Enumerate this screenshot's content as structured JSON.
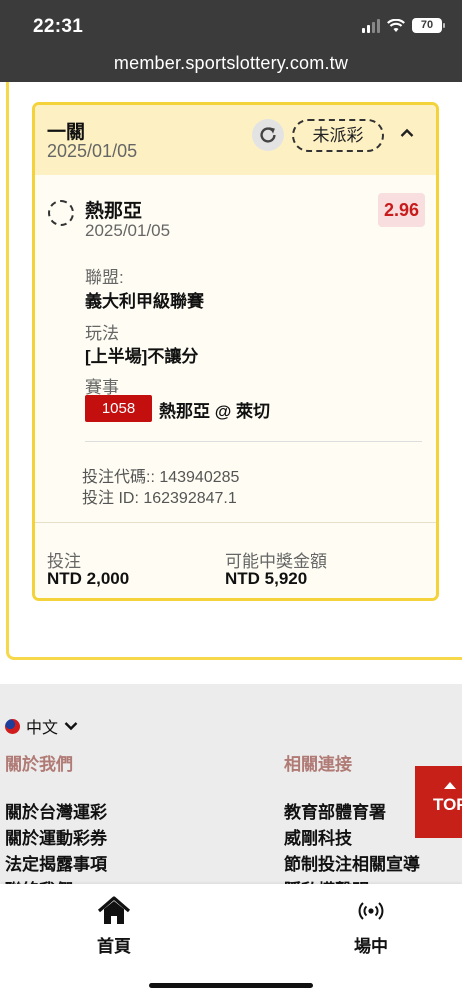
{
  "status_bar": {
    "time": "22:31",
    "battery": "70",
    "icons": [
      "cellular-signal-icon",
      "wifi-icon",
      "battery-icon"
    ]
  },
  "browser": {
    "url": "member.sportslottery.com.tw"
  },
  "ticket": {
    "type": "一關",
    "date": "2025/01/05",
    "status": "未派彩",
    "refresh_icon": "refresh-icon",
    "collapse_icon": "chevron-up-icon",
    "leg": {
      "team": "熱那亞",
      "date": "2025/01/05",
      "odds": "2.96",
      "league_label": "聯盟:",
      "league": "義大利甲級聯賽",
      "play_label": "玩法",
      "play": "[上半場]不讓分",
      "event_label": "賽事",
      "match_no": "1058",
      "match": "熱那亞 @ 萊切"
    },
    "bet_code": "投注代碼:: 143940285",
    "bet_id": "投注 ID: 162392847.1",
    "stake_label": "投注",
    "stake": "NTD 2,000",
    "payout_label": "可能中獎金額",
    "payout": "NTD 5,920"
  },
  "footer": {
    "language": "中文",
    "about_heading": "關於我們",
    "links_heading": "相關連接",
    "about_links": [
      "關於台灣運彩",
      "關於運動彩券",
      "法定揭露事項",
      "聯絡我們"
    ],
    "related_links": [
      "教育部體育署",
      "威剛科技",
      "節制投注相關宣導",
      "隱私權聲明"
    ],
    "to_top": "TOP"
  },
  "bottom_nav": {
    "home": "首頁",
    "live": "場中"
  },
  "colors": {
    "accent_yellow": "#f4d33a",
    "header_yellow": "#fdf1c4",
    "match_red": "#c40f0f",
    "odds_red": "#c81c1c",
    "top_button": "#c62019"
  }
}
